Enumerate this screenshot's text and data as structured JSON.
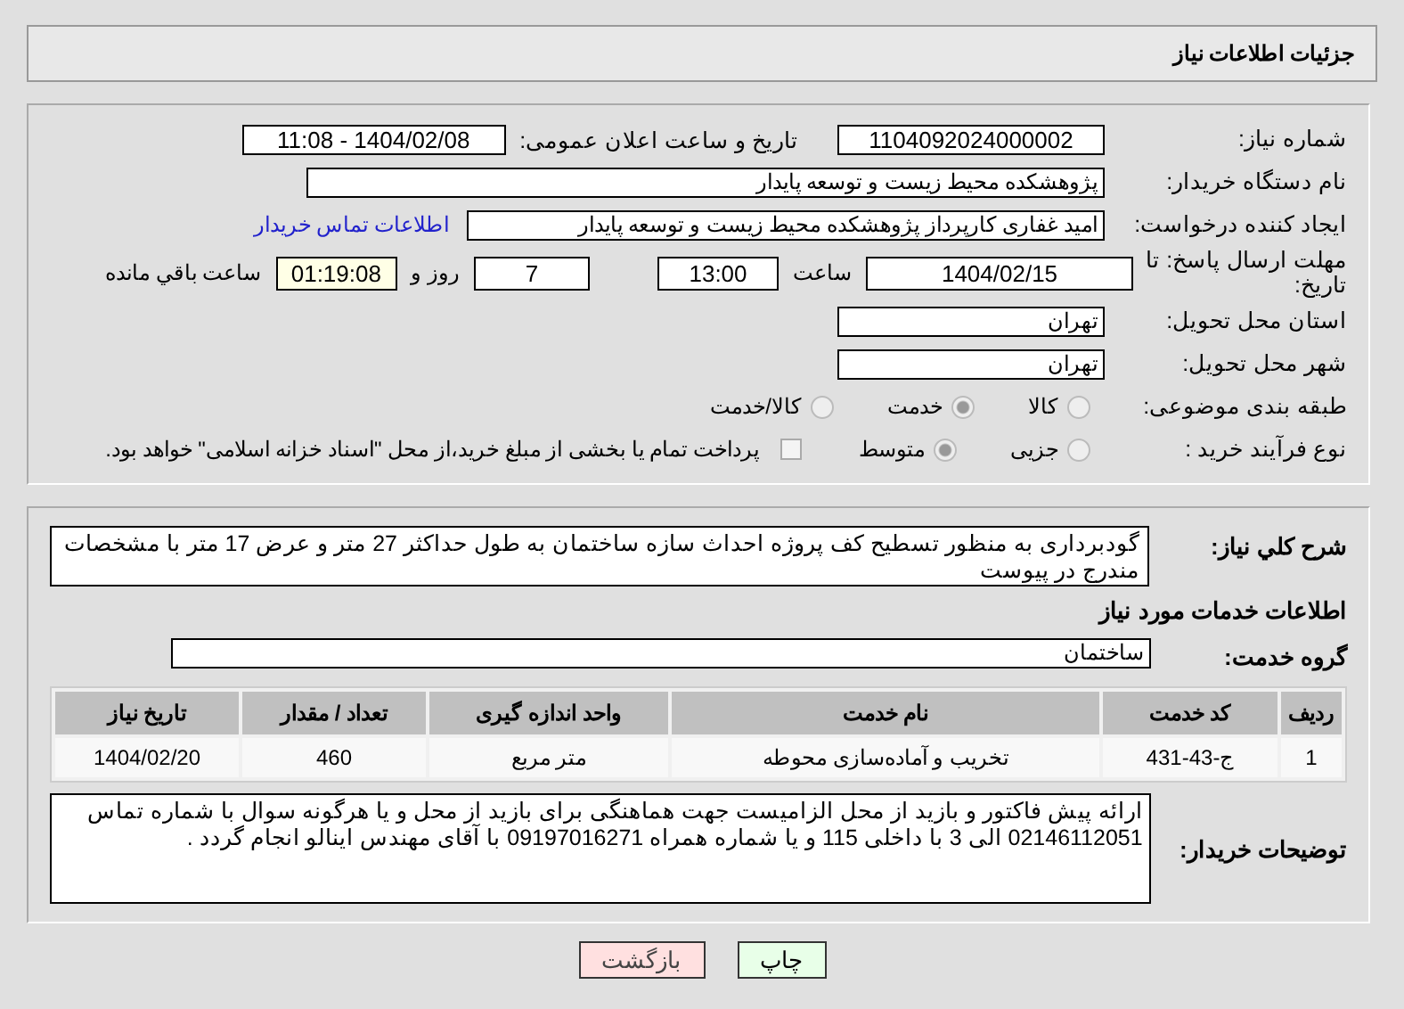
{
  "header": {
    "title": "جزئیات اطلاعات نیاز"
  },
  "need_number": {
    "label": "شماره نیاز:",
    "value": "1104092024000002"
  },
  "announce": {
    "label": "تاریخ و ساعت اعلان عمومی:",
    "value": "1404/02/08 - 11:08"
  },
  "buyer": {
    "label": "نام دستگاه خریدار:",
    "value": "پژوهشکده محیط زیست و توسعه پایدار"
  },
  "creator": {
    "label": "ایجاد کننده درخواست:",
    "value": "امید غفاری کارپرداز پژوهشکده محیط زیست و توسعه پایدار",
    "link": "اطلاعات تماس خریدار"
  },
  "deadline": {
    "label": "مهلت ارسال پاسخ: تا تاریخ:",
    "date": "1404/02/15",
    "time_label": "ساعت",
    "time": "13:00",
    "days": "7",
    "days_label": "روز و",
    "remaining": "01:19:08",
    "remaining_label": "ساعت باقي مانده"
  },
  "province": {
    "label": "استان محل تحویل:",
    "value": "تهران"
  },
  "city": {
    "label": "شهر محل تحویل:",
    "value": "تهران"
  },
  "category": {
    "label": "طبقه بندی موضوعی:",
    "options": [
      {
        "label": "کالا",
        "selected": false
      },
      {
        "label": "خدمت",
        "selected": true
      },
      {
        "label": "کالا/خدمت",
        "selected": false
      }
    ]
  },
  "process": {
    "label": "نوع فرآیند خرید :",
    "options": [
      {
        "label": "جزیی",
        "selected": false
      },
      {
        "label": "متوسط",
        "selected": true
      }
    ],
    "payment": {
      "label": "پرداخت تمام یا بخشی از مبلغ خرید،از محل \"اسناد خزانه اسلامی\" خواهد بود.",
      "checked": false
    }
  },
  "description": {
    "label": "شرح کلي نياز:",
    "value": "گودبرداری به منظور تسطیح کف پروژه احداث سازه ساختمان به طول حداکثر 27 متر و عرض 17 متر با مشخصات مندرج در پیوست"
  },
  "services_title": "اطلاعات خدمات مورد نياز",
  "service_group": {
    "label": "گروه خدمت:",
    "value": "ساختمان"
  },
  "table": {
    "columns": [
      "ردیف",
      "کد خدمت",
      "نام خدمت",
      "واحد اندازه گیری",
      "تعداد / مقدار",
      "تاریخ نیاز"
    ],
    "rows": [
      [
        "1",
        "ج-43-431",
        "تخریب و آماده‌سازی محوطه",
        "متر مربع",
        "460",
        "1404/02/20"
      ]
    ]
  },
  "buyer_notes": {
    "label": "توضیحات خریدار:",
    "value": "ارائه پیش فاکتور و بازید از محل  الزامیست جهت هماهنگی برای بازید از محل و یا هرگونه سوال  با شماره تماس 02146112051 الی 3 با داخلی 115 و یا شماره همراه 09197016271  با آقای مهندس اینالو انجام گردد ."
  },
  "buttons": [
    {
      "label": "چاپ",
      "kind": "print"
    },
    {
      "label": "بازگشت",
      "kind": "back"
    }
  ]
}
